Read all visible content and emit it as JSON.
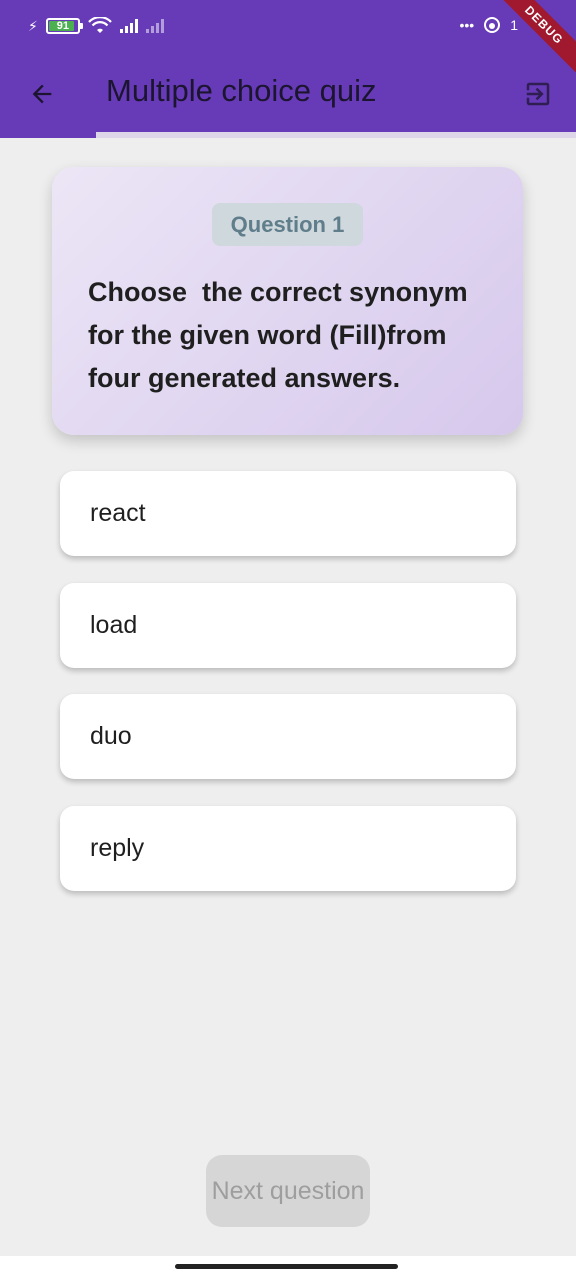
{
  "status_bar": {
    "battery": "91",
    "icons": [
      "charging-bolt-icon",
      "battery-icon",
      "wifi-icon",
      "signal-icon",
      "signal-no-service-icon",
      "more-dots-icon",
      "notification-icon"
    ],
    "time_fragment": "1"
  },
  "debug_banner": "DEBUG",
  "app_bar": {
    "title": "Multiple choice quiz",
    "back_icon": "arrow-back-icon",
    "exit_icon": "exit-to-app-icon",
    "background": "#673ab7"
  },
  "progress": {
    "value": 0.167
  },
  "question": {
    "badge": "Question 1",
    "text": "Choose  the correct synonym for the given word (Fill)from four generated answers."
  },
  "answers": [
    "react",
    "load",
    "duo",
    "reply"
  ],
  "next_button": {
    "label": "Next question",
    "enabled": false
  }
}
